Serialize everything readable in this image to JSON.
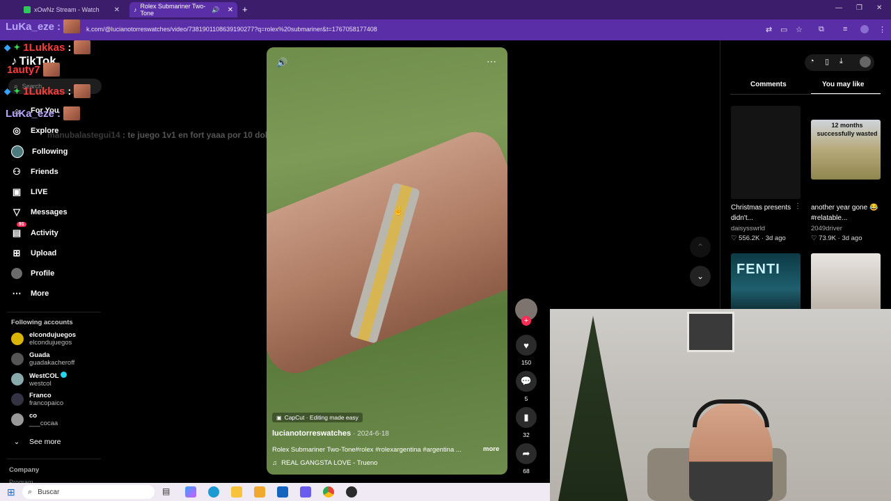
{
  "browser": {
    "tabs": [
      {
        "label": "xOwNz Stream - Watch",
        "active": false
      },
      {
        "label": "Rolex Submariner Two-Tone",
        "active": true
      }
    ],
    "new_tab_icon": "+",
    "url": "k.com/@lucianotorreswatches/video/7381901108639190277?q=rolex%20submariner&t=1767058177408"
  },
  "chat_overlay": [
    {
      "user": "1Lukkas",
      "color": "#ff3b3b"
    },
    {
      "user": "LuKa_eze",
      "color": "#b8a6ff"
    },
    {
      "user": "1Lukkas",
      "color": "#ff3b3b"
    },
    {
      "user": "1auty7",
      "color": "#ff3b3b"
    },
    {
      "user": "1Lukkas",
      "color": "#ff3b3b"
    },
    {
      "user": "LuKa_eze",
      "color": "#b8a6ff"
    }
  ],
  "chat_message": {
    "user": "manubalastegui14",
    "text": ": te juego 1v1 en fort yaaa por 10 dolares"
  },
  "sidebar": {
    "logo": "TikTok",
    "search_placeholder": "Search",
    "nav": [
      {
        "label": "For You",
        "icon": "home-icon"
      },
      {
        "label": "Explore",
        "icon": "compass-icon"
      },
      {
        "label": "Following",
        "icon": "avatar-icon"
      },
      {
        "label": "Friends",
        "icon": "friends-icon"
      },
      {
        "label": "LIVE",
        "icon": "live-icon"
      },
      {
        "label": "Messages",
        "icon": "send-icon"
      },
      {
        "label": "Activity",
        "icon": "inbox-icon",
        "badge": "91"
      },
      {
        "label": "Upload",
        "icon": "plus-square-icon"
      },
      {
        "label": "Profile",
        "icon": "avatar-icon"
      },
      {
        "label": "More",
        "icon": "more-icon"
      }
    ],
    "following_header": "Following accounts",
    "accounts": [
      {
        "name": "elcondujuegos",
        "handle": "elcondujuegos"
      },
      {
        "name": "Guada",
        "handle": "guadakacheroff"
      },
      {
        "name": "WestCOL",
        "handle": "westcol",
        "verified": true
      },
      {
        "name": "Franco",
        "handle": "francopaico"
      },
      {
        "name": "co",
        "handle": "___cocaa"
      }
    ],
    "see_more": "See more",
    "company": "Company",
    "program": "Program"
  },
  "video": {
    "capcut": "CapCut · Editing made easy",
    "author": "lucianotorreswatches",
    "date": "· 2024-6-18",
    "caption": "Rolex Submariner Two-Tone#rolex #rolexargentina #argentina ...",
    "more": "more",
    "music": "REAL GANGSTA LOVE - Trueno",
    "likes": "150",
    "comments": "5",
    "saves": "32",
    "shares": "68"
  },
  "right_panel": {
    "tabs": [
      "Comments",
      "You may like"
    ],
    "active_tab": "You may like",
    "items": [
      {
        "title": "Christmas presents didn't...",
        "author": "daisysswrld",
        "stats": "556.2K · 3d ago"
      },
      {
        "title": "another year gone 😂 #relatable...",
        "author": "2049driver",
        "stats": "73.9K · 3d ago",
        "thumb_text": "12 months successfully wasted"
      },
      {
        "thumb_text": "FENTI"
      },
      {}
    ]
  },
  "taskbar": {
    "search_placeholder": "Buscar"
  },
  "colors": {
    "tab_bar": "#3b1d6b",
    "address_bar": "#5a2ea6",
    "tiktok_red": "#fe2c55",
    "taskbar": "#efeaf3"
  }
}
